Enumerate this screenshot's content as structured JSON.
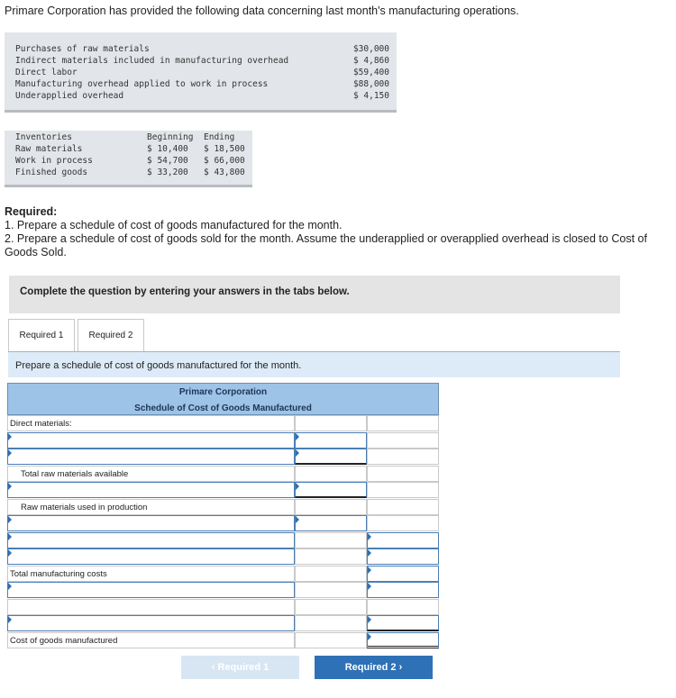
{
  "intro": "Primare Corporation has provided the following data concerning last month's manufacturing operations.",
  "costs": [
    {
      "label": "Purchases of raw materials",
      "value": "$30,000"
    },
    {
      "label": "Indirect materials included in manufacturing overhead",
      "value": "$ 4,860"
    },
    {
      "label": "Direct labor",
      "value": "$59,400"
    },
    {
      "label": "Manufacturing overhead applied to work in process",
      "value": "$88,000"
    },
    {
      "label": "Underapplied overhead",
      "value": "$ 4,150"
    }
  ],
  "inventories": {
    "header": {
      "label": "Inventories",
      "beginning": "Beginning",
      "ending": "Ending"
    },
    "rows": [
      {
        "label": "Raw materials",
        "beginning": "$ 10,400",
        "ending": "$ 18,500"
      },
      {
        "label": "Work in process",
        "beginning": "$ 54,700",
        "ending": "$ 66,000"
      },
      {
        "label": "Finished goods",
        "beginning": "$ 33,200",
        "ending": "$ 43,800"
      }
    ]
  },
  "required": {
    "heading": "Required:",
    "item1": "1. Prepare a schedule of cost of goods manufactured for the month.",
    "item2": "2. Prepare a schedule of cost of goods sold for the month. Assume the underapplied or overapplied overhead is closed to Cost of Goods Sold."
  },
  "banner": "Complete the question by entering your answers in the tabs below.",
  "tabs": [
    "Required 1",
    "Required 2"
  ],
  "prompt": "Prepare a schedule of cost of goods manufactured for the month.",
  "schedule": {
    "company": "Primare Corporation",
    "title": "Schedule of Cost of Goods Manufactured",
    "labels": {
      "direct_materials": "Direct materials:",
      "total_raw": "Total raw materials available",
      "raw_used": "Raw materials used in production",
      "total_mfg": "Total manufacturing costs",
      "cogm": "Cost of goods manufactured"
    }
  },
  "nav": {
    "prev": "Required 1",
    "next": "Required 2"
  }
}
